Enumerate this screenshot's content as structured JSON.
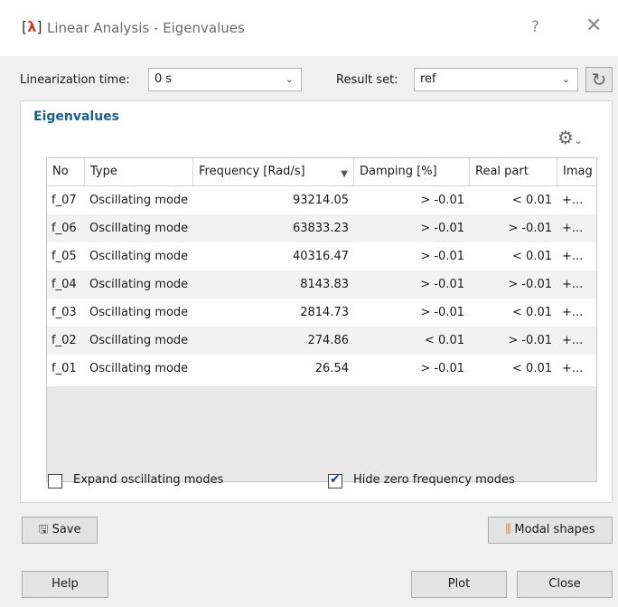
{
  "window": {
    "icon": "[λ]",
    "title": "Linear Analysis - Eigenvalues",
    "help": "?",
    "close": "✕"
  },
  "top": {
    "lin_time_label": "Linearization time:",
    "lin_time_value": "0 s",
    "result_set_label": "Result set:",
    "result_set_value": "ref"
  },
  "eigen": {
    "title": "Eigenvalues",
    "columns": [
      "No",
      "Type",
      "Frequency [Rad/s]",
      "Damping [%]",
      "Real part",
      "Imag"
    ],
    "rows": [
      [
        "f_07",
        "Oscillating mode",
        "93214.05",
        "> -0.01",
        "< 0.01",
        "+..."
      ],
      [
        "f_06",
        "Oscillating mode",
        "63833.23",
        "> -0.01",
        "> -0.01",
        "+..."
      ],
      [
        "f_05",
        "Oscillating mode",
        "40316.47",
        "> -0.01",
        "< 0.01",
        "+..."
      ],
      [
        "f_04",
        "Oscillating mode",
        "8143.83",
        "> -0.01",
        "> -0.01",
        "+..."
      ],
      [
        "f_03",
        "Oscillating mode",
        "2814.73",
        "> -0.01",
        "< 0.01",
        "+..."
      ],
      [
        "f_02",
        "Oscillating mode",
        "274.86",
        "< 0.01",
        "> -0.01",
        "+..."
      ],
      [
        "f_01",
        "Oscillating mode",
        "26.54",
        "> -0.01",
        "< 0.01",
        "+..."
      ]
    ],
    "expand_label": "Expand oscillating modes",
    "expand_checked": false,
    "hide_zero_label": "Hide zero frequency modes",
    "hide_zero_checked": true
  },
  "buttons": {
    "save": "Save",
    "modal_shapes": "Modal shapes",
    "help": "Help",
    "plot": "Plot",
    "close": "Close"
  },
  "icons": [
    "lambda-app-icon",
    "help-icon",
    "close-icon",
    "chevron-down-icon",
    "refresh-icon",
    "gear-icon",
    "sort-icon",
    "save-icon",
    "modal-shapes-icon",
    "checkmark-icon"
  ],
  "colors": {
    "group_title": "#1b5e8a",
    "row_even": "#ffffff",
    "row_odd": "#f2f2f2",
    "app_icon": "#c8402a"
  }
}
